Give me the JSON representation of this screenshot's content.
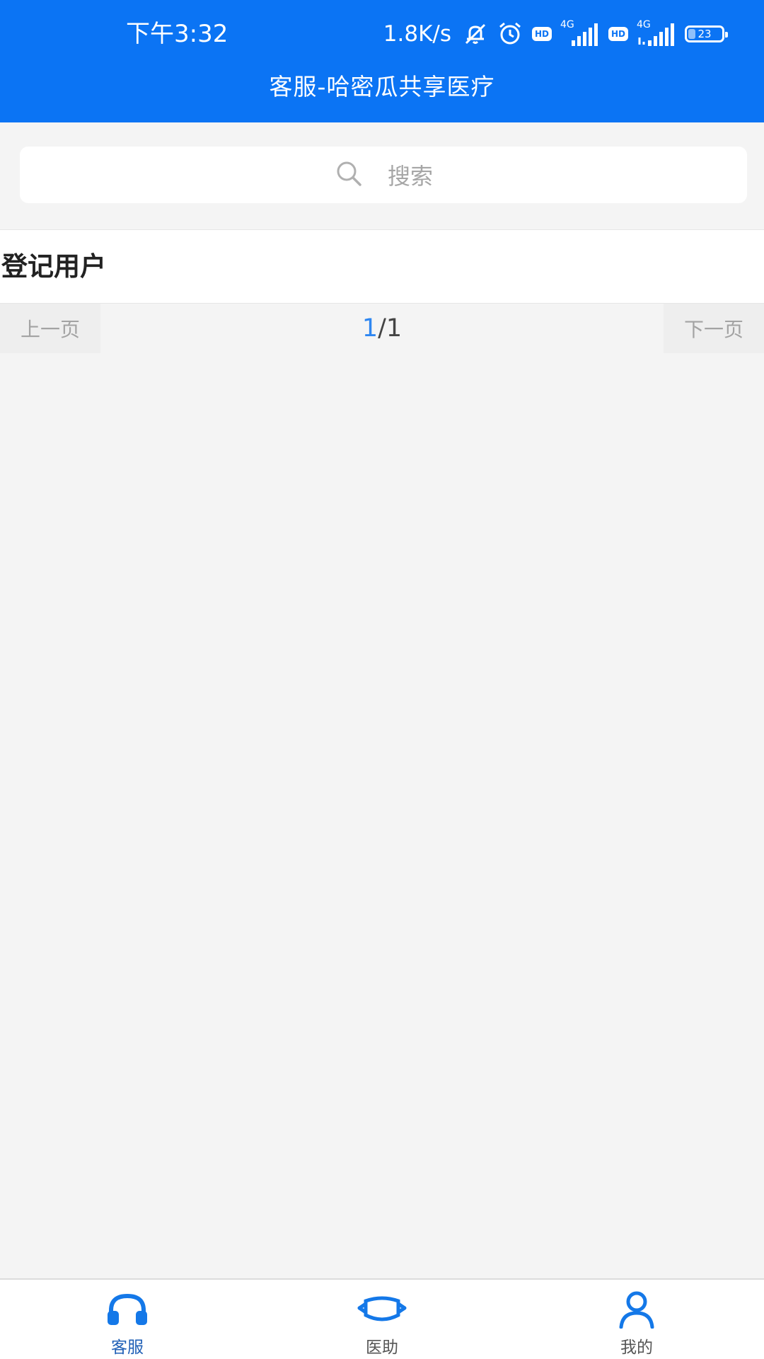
{
  "status_bar": {
    "time": "下午3:32",
    "net_speed": "1.8K/s",
    "hd_label": "HD",
    "network_label": "4G",
    "battery_level": "23",
    "icons": [
      "mute-bell-icon",
      "alarm-icon",
      "hd-icon",
      "signal-icon",
      "hd-icon",
      "signal-icon",
      "battery-icon"
    ]
  },
  "header": {
    "title": "客服-哈密瓜共享医疗"
  },
  "search": {
    "placeholder": "搜索",
    "icon": "search-icon"
  },
  "section": {
    "title": "登记用户"
  },
  "pager": {
    "prev_label": "上一页",
    "next_label": "下一页",
    "current_page": "1",
    "separator": "/",
    "total_pages": "1"
  },
  "tabbar": {
    "active_color": "#1f5fb6",
    "tabs": [
      {
        "label": "客服",
        "icon": "headset-icon",
        "active": true
      },
      {
        "label": "医助",
        "icon": "mask-icon",
        "active": false
      },
      {
        "label": "我的",
        "icon": "person-icon",
        "active": false
      }
    ]
  },
  "colors": {
    "header_bg": "#0b74f4",
    "page_bg": "#f4f4f4",
    "accent": "#2d86f1"
  }
}
